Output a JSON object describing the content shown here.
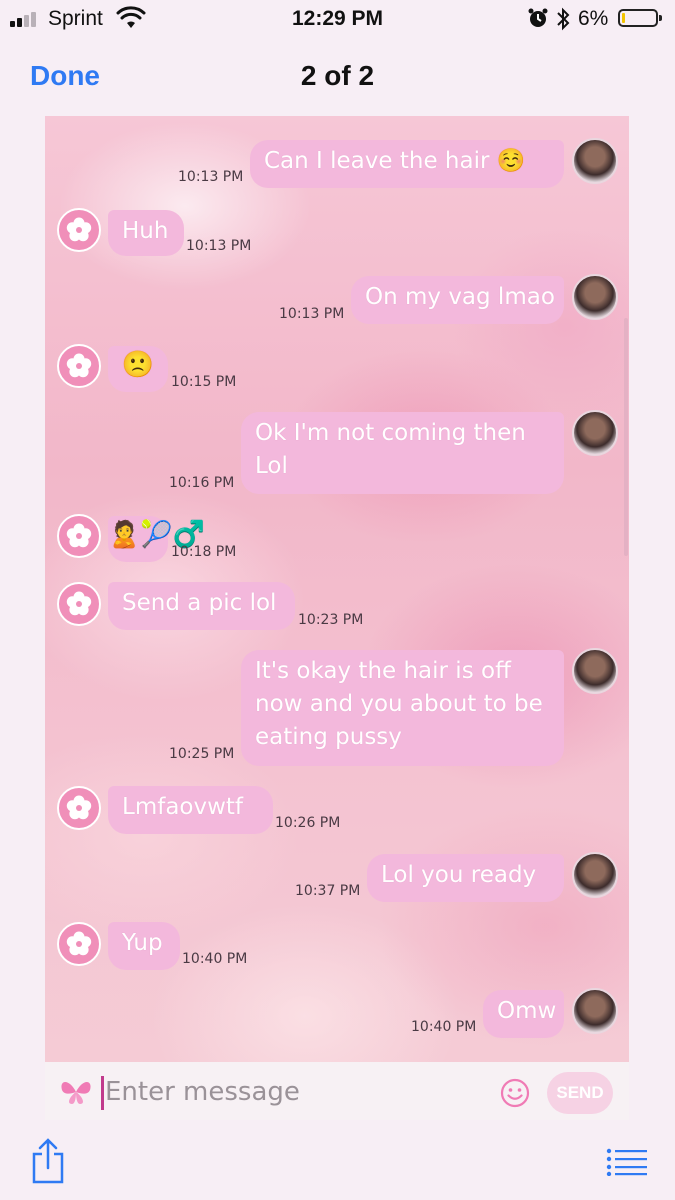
{
  "status": {
    "carrier": "Sprint",
    "time": "12:29 PM",
    "battery": "6%",
    "battery_level": 0.06
  },
  "nav": {
    "done_label": "Done",
    "page_count": "2 of 2"
  },
  "messages": [
    {
      "dir": "out",
      "text": "Can I leave the hair ☺️",
      "time": "10:13 PM"
    },
    {
      "dir": "in",
      "text": "Huh",
      "time": "10:13 PM"
    },
    {
      "dir": "out",
      "text": "On my vag lmao",
      "time": "10:13 PM"
    },
    {
      "dir": "in",
      "text": "🙁",
      "time": "10:15 PM"
    },
    {
      "dir": "out",
      "text": "Ok I'm not coming then Lol",
      "time": "10:16 PM"
    },
    {
      "dir": "in",
      "text": "🙎🎾‍♂️",
      "time": "10:18 PM"
    },
    {
      "dir": "in",
      "text": "Send a pic lol",
      "time": "10:23 PM"
    },
    {
      "dir": "out",
      "text": "It's okay the hair is off now and you about to be eating pussy",
      "time": "10:25 PM"
    },
    {
      "dir": "in",
      "text": "Lmfaovwtf",
      "time": "10:26 PM"
    },
    {
      "dir": "out",
      "text": "Lol you ready",
      "time": "10:37 PM"
    },
    {
      "dir": "in",
      "text": "Yup",
      "time": "10:40 PM"
    },
    {
      "dir": "out",
      "text": "Omw",
      "time": "10:40 PM"
    }
  ],
  "composer": {
    "placeholder": "Enter message",
    "send_label": "SEND"
  },
  "colors": {
    "bubble": "#f3b8dc",
    "accent": "#2f7af3",
    "avatar": "#f08fb9"
  },
  "icons": [
    "share-icon",
    "list-icon",
    "butterfly-icon",
    "smiley-icon",
    "flower-avatar-icon"
  ]
}
